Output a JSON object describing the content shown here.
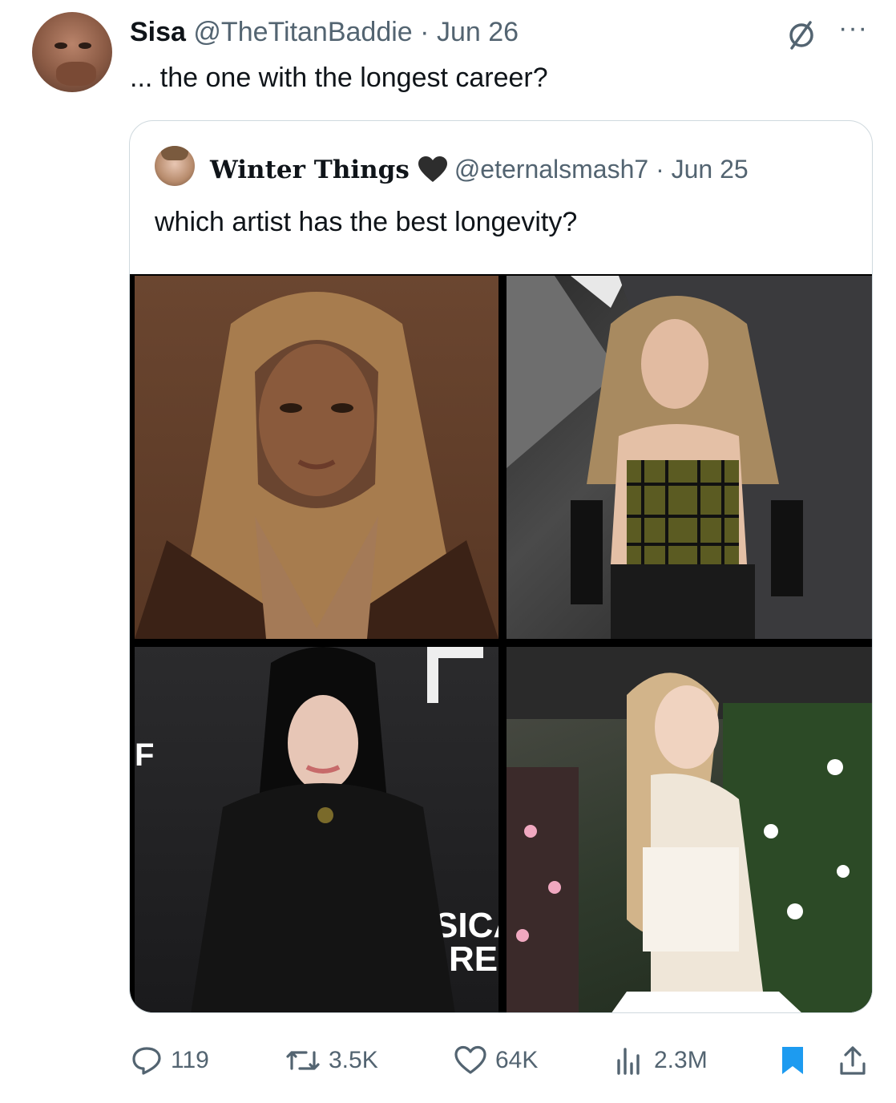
{
  "tweet": {
    "display_name": "Sisa",
    "handle": "@TheTitanBaddie",
    "separator": "·",
    "date": "Jun 26",
    "text": "... the one with the longest career?"
  },
  "quote": {
    "display_name": "Winter Things",
    "handle": "@eternalsmash7",
    "separator": "·",
    "date": "Jun 25",
    "text": "which artist has the best longevity?",
    "photos": [
      "woman-in-brown-blazer-photo",
      "woman-in-plaid-corset-photo",
      "woman-in-black-leather-photo",
      "woman-in-white-corset-photo"
    ]
  },
  "backdrop_text": {
    "left_letter": "F",
    "sign_line1": "SICA",
    "sign_line2": "RE"
  },
  "actions": {
    "replies": "119",
    "reposts": "3.5K",
    "likes": "64K",
    "views": "2.3M"
  },
  "colors": {
    "text": "#0f1419",
    "secondary": "#536471",
    "accent": "#1d9bf0",
    "border": "#cfd9de"
  },
  "icons": [
    "grok-icon",
    "more-icon",
    "heart-emoji-icon",
    "reply-icon",
    "repost-icon",
    "like-icon",
    "views-icon",
    "bookmark-icon",
    "share-icon"
  ]
}
